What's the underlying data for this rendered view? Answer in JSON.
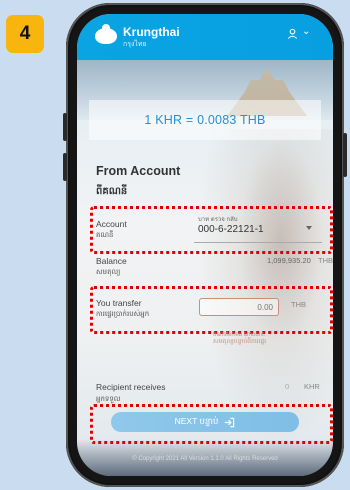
{
  "step_number": "4",
  "app": {
    "name": "Krungthai",
    "name_sub": "กรุงไทย",
    "user_chevron": "⌄"
  },
  "rate": {
    "text": "1 KHR = 0.0083 THB"
  },
  "from_account": {
    "title": "From Account",
    "title_khmer": "ពីគណនី"
  },
  "account": {
    "label": "Account",
    "label_khmer": "គណនី",
    "selector_small": "บาท ตรวจ กลับ",
    "number": "000-6-22121-1"
  },
  "balance": {
    "label": "Balance",
    "label_khmer": "សមតុល្យ",
    "value": "1,099,935.20",
    "currency": "THB"
  },
  "transfer": {
    "label": "You transfer",
    "label_khmer": "ការផ្ទេរប្រាក់របស់អ្នក",
    "input_placeholder": "0.00",
    "currency": "THB",
    "note": "transferred amount. សមតុល្យបន្ទាប់ពីការផ្ទេរ"
  },
  "recipient": {
    "label": "Recipient receives",
    "label_khmer": "អ្នកទទួល",
    "value": "0",
    "currency": "KHR"
  },
  "next_button": {
    "label": "NEXT បន្ទាប់"
  },
  "footer": {
    "text": "© Copyright 2021 All Version 1.1.0 All Rights Reserved"
  },
  "colors": {
    "brand_blue": "#0aa4e3",
    "highlight_red": "#e00000",
    "step_badge": "#f7b50d"
  }
}
